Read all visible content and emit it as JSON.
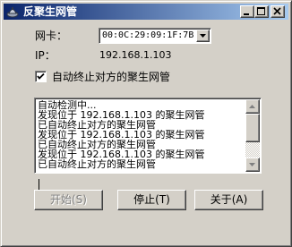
{
  "window": {
    "title": "反聚生网管"
  },
  "form": {
    "nic_label": "网卡：",
    "nic_selected": "00:0C:29:09:1F:7B",
    "ip_label": "IP：",
    "ip_value": "192.168.1.103",
    "auto_kill_label": "自动终止对方的聚生网管",
    "auto_kill_checked": true
  },
  "log": {
    "lines": [
      "自动检测中...",
      "发现位于 192.168.1.103 的聚生网管",
      "已自动终止对方的聚生网管",
      "发现位于 192.168.1.103 的聚生网管",
      "已自动终止对方的聚生网管",
      "发现位于 192.168.1.103 的聚生网管",
      "已自动终止对方的聚生网管"
    ]
  },
  "buttons": {
    "start": "开始(S)",
    "stop": "停止(T)",
    "about": "关于(A)"
  },
  "colors": {
    "titlebar_start": "#0a246a",
    "titlebar_end": "#a6caf0",
    "face": "#d4d0c8"
  }
}
